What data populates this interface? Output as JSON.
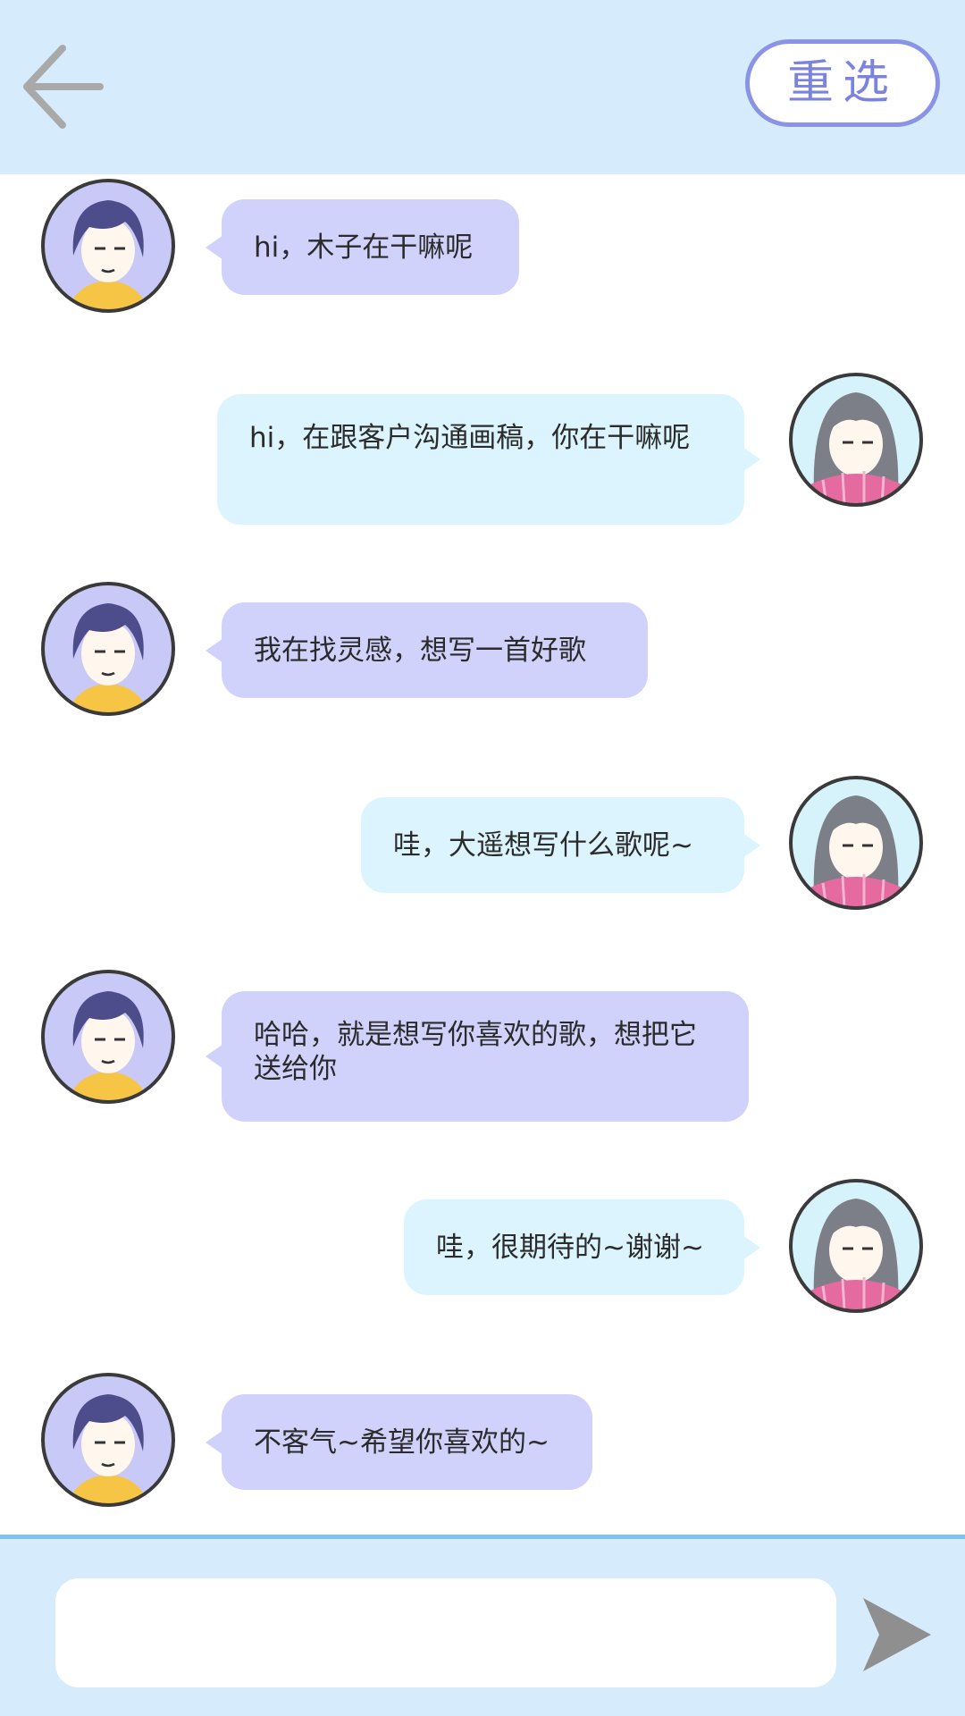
{
  "header": {
    "back_icon": "arrow-left-icon",
    "reselect_label": "重选"
  },
  "messages": [
    {
      "side": "left",
      "sender": "boy",
      "text": "hi，木子在干嘛呢"
    },
    {
      "side": "right",
      "sender": "girl",
      "text": "hi，在跟客户沟通画稿，你在干嘛呢"
    },
    {
      "side": "left",
      "sender": "boy",
      "text": "我在找灵感，想写一首好歌"
    },
    {
      "side": "right",
      "sender": "girl",
      "text": "哇，大遥想写什么歌呢~"
    },
    {
      "side": "left",
      "sender": "boy",
      "text": "哈哈，就是想写你喜欢的歌，想把它送给你"
    },
    {
      "side": "right",
      "sender": "girl",
      "text": "哇，很期待的~谢谢~"
    },
    {
      "side": "left",
      "sender": "boy",
      "text": "不客气~希望你喜欢的~"
    }
  ],
  "footer": {
    "input_value": "",
    "send_icon": "send-arrow-icon"
  },
  "colors": {
    "header_bg": "#d6ecfd",
    "left_bubble": "#d0d2fb",
    "right_bubble": "#dbf4fd",
    "accent": "#8b93e6",
    "footer_border": "#7cc4f4"
  }
}
